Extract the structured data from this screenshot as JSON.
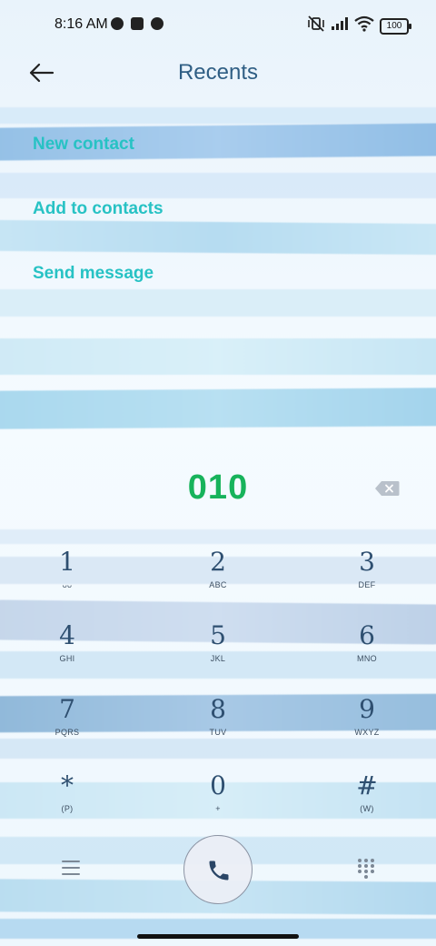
{
  "status_bar": {
    "time": "8:16 AM",
    "battery": "100"
  },
  "header": {
    "title": "Recents"
  },
  "actions": [
    "New contact",
    "Add to contacts",
    "Send message"
  ],
  "dialed_number": "010",
  "keypad": [
    {
      "digit": "1",
      "letters": "ᴗᴗ"
    },
    {
      "digit": "2",
      "letters": "ABC"
    },
    {
      "digit": "3",
      "letters": "DEF"
    },
    {
      "digit": "4",
      "letters": "GHI"
    },
    {
      "digit": "5",
      "letters": "JKL"
    },
    {
      "digit": "6",
      "letters": "MNO"
    },
    {
      "digit": "7",
      "letters": "PQRS"
    },
    {
      "digit": "8",
      "letters": "TUV"
    },
    {
      "digit": "9",
      "letters": "WXYZ"
    },
    {
      "digit": "*",
      "letters": "(P)"
    },
    {
      "digit": "0",
      "letters": "+"
    },
    {
      "digit": "#",
      "letters": "(W)"
    }
  ],
  "colors": {
    "accent_teal": "#27c2c4",
    "number_green": "#17b35b",
    "title_blue": "#2f5e84"
  },
  "icons": [
    "back-arrow-icon",
    "backspace-icon",
    "menu-icon",
    "phone-icon",
    "dialpad-icon"
  ]
}
